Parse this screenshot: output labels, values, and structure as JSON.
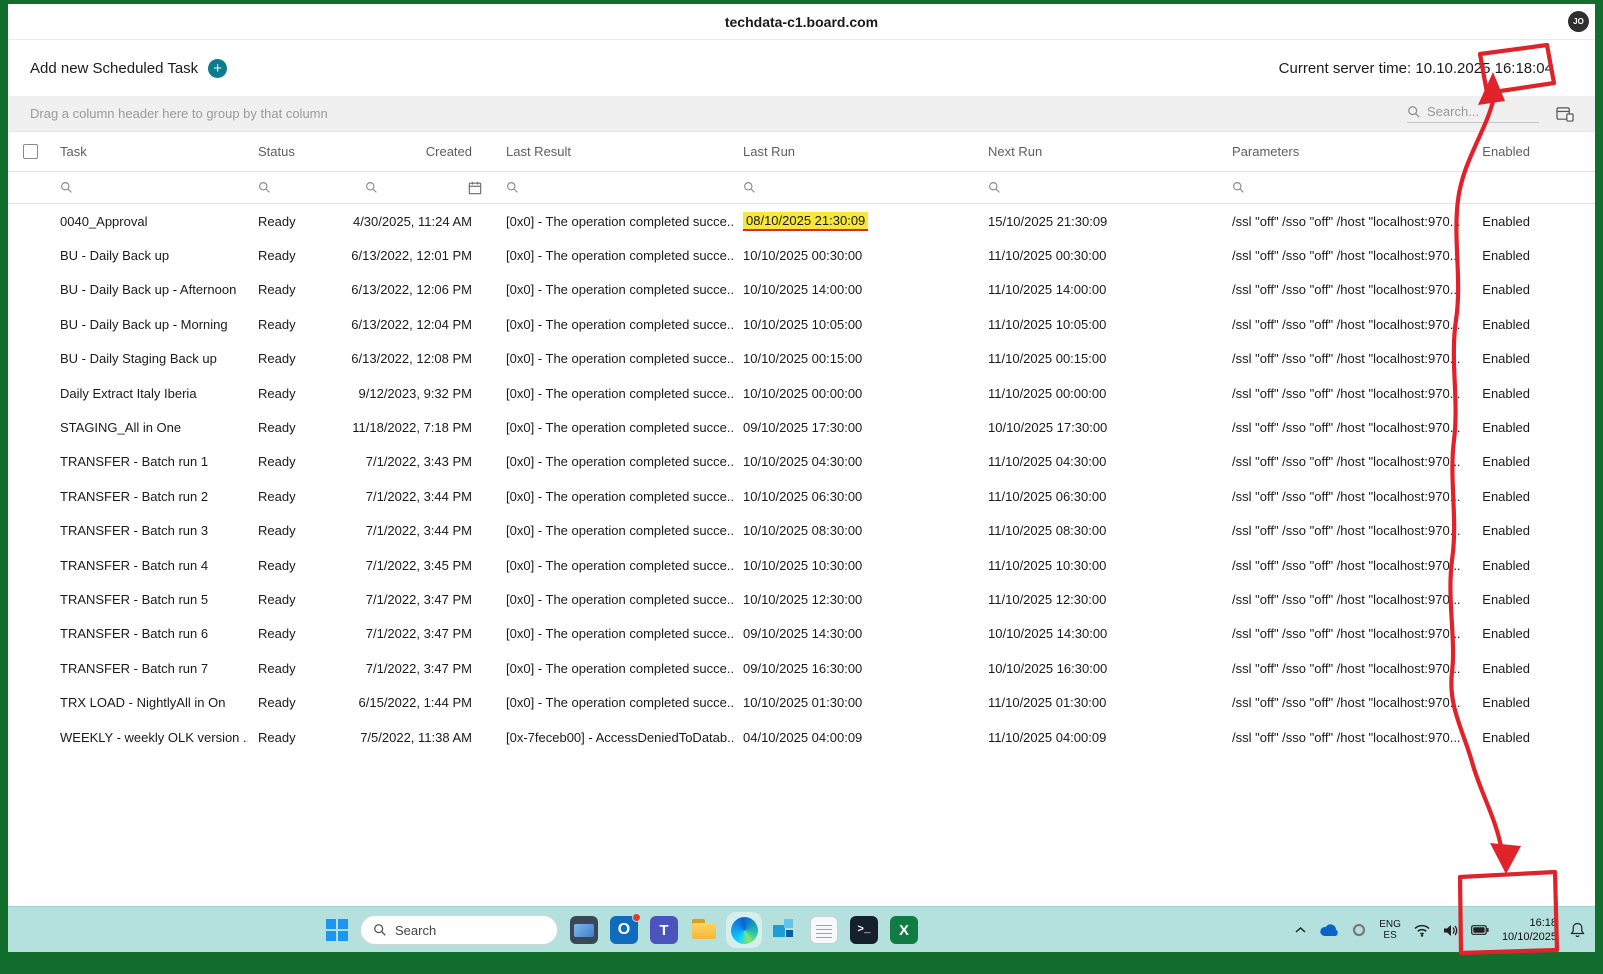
{
  "window": {
    "title": "techdata-c1.board.com",
    "avatar_initials": "JO"
  },
  "header": {
    "add_task_label": "Add new Scheduled Task",
    "server_time": "Current server time: 10.10.2025 16:18:04"
  },
  "toolbar": {
    "group_hint": "Drag a column header here to group by that column",
    "search_placeholder": "Search..."
  },
  "table": {
    "columns": {
      "task": "Task",
      "status": "Status",
      "created": "Created",
      "last_result": "Last Result",
      "last_run": "Last Run",
      "next_run": "Next Run",
      "parameters": "Parameters",
      "enabled": "Enabled"
    },
    "rows": [
      {
        "task": "0040_Approval",
        "status": "Ready",
        "created": "4/30/2025, 11:24 AM",
        "last_result": "[0x0] - The operation completed succe...",
        "last_run": "08/10/2025 21:30:09",
        "next_run": "15/10/2025 21:30:09",
        "parameters": "/ssl \"off\" /sso \"off\" /host \"localhost:970...",
        "enabled": "Enabled",
        "highlight_last_run": true
      },
      {
        "task": "BU - Daily Back up",
        "status": "Ready",
        "created": "6/13/2022, 12:01 PM",
        "last_result": "[0x0] - The operation completed succe...",
        "last_run": "10/10/2025 00:30:00",
        "next_run": "11/10/2025 00:30:00",
        "parameters": "/ssl \"off\" /sso \"off\" /host \"localhost:970...",
        "enabled": "Enabled"
      },
      {
        "task": "BU - Daily Back up - Afternoon",
        "status": "Ready",
        "created": "6/13/2022, 12:06 PM",
        "last_result": "[0x0] - The operation completed succe...",
        "last_run": "10/10/2025 14:00:00",
        "next_run": "11/10/2025 14:00:00",
        "parameters": "/ssl \"off\" /sso \"off\" /host \"localhost:970...",
        "enabled": "Enabled"
      },
      {
        "task": "BU - Daily Back up - Morning",
        "status": "Ready",
        "created": "6/13/2022, 12:04 PM",
        "last_result": "[0x0] - The operation completed succe...",
        "last_run": "10/10/2025 10:05:00",
        "next_run": "11/10/2025 10:05:00",
        "parameters": "/ssl \"off\" /sso \"off\" /host \"localhost:970...",
        "enabled": "Enabled"
      },
      {
        "task": "BU - Daily Staging Back up",
        "status": "Ready",
        "created": "6/13/2022, 12:08 PM",
        "last_result": "[0x0] - The operation completed succe...",
        "last_run": "10/10/2025 00:15:00",
        "next_run": "11/10/2025 00:15:00",
        "parameters": "/ssl \"off\" /sso \"off\" /host \"localhost:970...",
        "enabled": "Enabled"
      },
      {
        "task": "Daily Extract Italy Iberia",
        "status": "Ready",
        "created": "9/12/2023, 9:32 PM",
        "last_result": "[0x0] - The operation completed succe...",
        "last_run": "10/10/2025 00:00:00",
        "next_run": "11/10/2025 00:00:00",
        "parameters": "/ssl \"off\" /sso \"off\" /host \"localhost:970...",
        "enabled": "Enabled"
      },
      {
        "task": "STAGING_All in One",
        "status": "Ready",
        "created": "11/18/2022, 7:18 PM",
        "last_result": "[0x0] - The operation completed succe...",
        "last_run": "09/10/2025 17:30:00",
        "next_run": "10/10/2025 17:30:00",
        "parameters": "/ssl \"off\" /sso \"off\" /host \"localhost:970...",
        "enabled": "Enabled"
      },
      {
        "task": "TRANSFER - Batch run 1",
        "status": "Ready",
        "created": "7/1/2022, 3:43 PM",
        "last_result": "[0x0] - The operation completed succe...",
        "last_run": "10/10/2025 04:30:00",
        "next_run": "11/10/2025 04:30:00",
        "parameters": "/ssl \"off\" /sso \"off\" /host \"localhost:970...",
        "enabled": "Enabled"
      },
      {
        "task": "TRANSFER - Batch run 2",
        "status": "Ready",
        "created": "7/1/2022, 3:44 PM",
        "last_result": "[0x0] - The operation completed succe...",
        "last_run": "10/10/2025 06:30:00",
        "next_run": "11/10/2025 06:30:00",
        "parameters": "/ssl \"off\" /sso \"off\" /host \"localhost:970...",
        "enabled": "Enabled"
      },
      {
        "task": "TRANSFER - Batch run 3",
        "status": "Ready",
        "created": "7/1/2022, 3:44 PM",
        "last_result": "[0x0] - The operation completed succe...",
        "last_run": "10/10/2025 08:30:00",
        "next_run": "11/10/2025 08:30:00",
        "parameters": "/ssl \"off\" /sso \"off\" /host \"localhost:970...",
        "enabled": "Enabled"
      },
      {
        "task": "TRANSFER - Batch run 4",
        "status": "Ready",
        "created": "7/1/2022, 3:45 PM",
        "last_result": "[0x0] - The operation completed succe...",
        "last_run": "10/10/2025 10:30:00",
        "next_run": "11/10/2025 10:30:00",
        "parameters": "/ssl \"off\" /sso \"off\" /host \"localhost:970...",
        "enabled": "Enabled"
      },
      {
        "task": "TRANSFER - Batch run 5",
        "status": "Ready",
        "created": "7/1/2022, 3:47 PM",
        "last_result": "[0x0] - The operation completed succe...",
        "last_run": "10/10/2025 12:30:00",
        "next_run": "11/10/2025 12:30:00",
        "parameters": "/ssl \"off\" /sso \"off\" /host \"localhost:970...",
        "enabled": "Enabled"
      },
      {
        "task": "TRANSFER - Batch run 6",
        "status": "Ready",
        "created": "7/1/2022, 3:47 PM",
        "last_result": "[0x0] - The operation completed succe...",
        "last_run": "09/10/2025 14:30:00",
        "next_run": "10/10/2025 14:30:00",
        "parameters": "/ssl \"off\" /sso \"off\" /host \"localhost:970...",
        "enabled": "Enabled"
      },
      {
        "task": "TRANSFER - Batch run 7",
        "status": "Ready",
        "created": "7/1/2022, 3:47 PM",
        "last_result": "[0x0] - The operation completed succe...",
        "last_run": "09/10/2025 16:30:00",
        "next_run": "10/10/2025 16:30:00",
        "parameters": "/ssl \"off\" /sso \"off\" /host \"localhost:970...",
        "enabled": "Enabled"
      },
      {
        "task": "TRX LOAD - NightlyAll in On",
        "status": "Ready",
        "created": "6/15/2022, 1:44 PM",
        "last_result": "[0x0] - The operation completed succe...",
        "last_run": "10/10/2025 01:30:00",
        "next_run": "11/10/2025 01:30:00",
        "parameters": "/ssl \"off\" /sso \"off\" /host \"localhost:970...",
        "enabled": "Enabled"
      },
      {
        "task": "WEEKLY - weekly OLK version ...",
        "status": "Ready",
        "created": "7/5/2022, 11:38 AM",
        "last_result": "[0x-7feceb00] - AccessDeniedToDatab...",
        "last_run": "04/10/2025 04:00:09",
        "next_run": "11/10/2025 04:00:09",
        "parameters": "/ssl \"off\" /sso \"off\" /host \"localhost:970...",
        "enabled": "Enabled"
      }
    ]
  },
  "taskbar": {
    "search_placeholder": "Search",
    "apps": [
      "desktop",
      "outlook",
      "teams",
      "file-explorer",
      "edge",
      "board",
      "notepad",
      "terminal",
      "excel"
    ],
    "outlook_letter": "O",
    "teams_letter": "T",
    "terminal_glyph": ">_",
    "excel_letter": "X",
    "language_line1": "ENG",
    "language_line2": "ES",
    "time": "16:18",
    "date": "10/10/2025"
  },
  "annotation": {
    "color": "#e0222a",
    "highlight_color": "#f6e738"
  }
}
